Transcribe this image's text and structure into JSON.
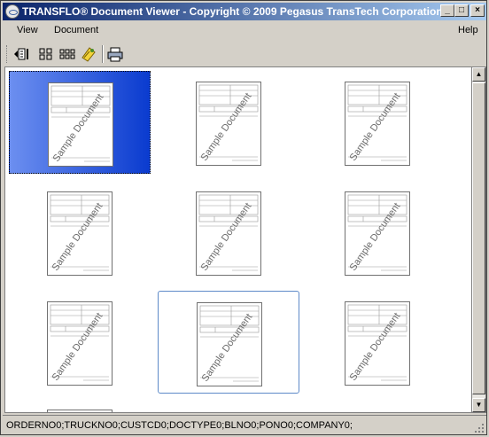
{
  "window": {
    "title": "TRANSFLO® Document Viewer - Copyright © 2009 Pegasus TransTech Corporation...",
    "controls": {
      "minimize": "_",
      "maximize": "□",
      "close": "×"
    }
  },
  "menubar": {
    "items": [
      {
        "label": "View"
      },
      {
        "label": "Document"
      },
      {
        "label": "Help"
      }
    ]
  },
  "toolbar": {
    "buttons": [
      {
        "icon": "single-page-view-icon"
      },
      {
        "icon": "grid-2x2-icon"
      },
      {
        "icon": "grid-3x3-icon"
      },
      {
        "icon": "annotate-icon"
      },
      {
        "icon": "print-icon"
      }
    ]
  },
  "thumbnails": {
    "watermark": "Sample Document",
    "items": [
      {
        "state": "selected"
      },
      {
        "state": "normal"
      },
      {
        "state": "normal"
      },
      {
        "state": "normal"
      },
      {
        "state": "normal"
      },
      {
        "state": "normal"
      },
      {
        "state": "normal"
      },
      {
        "state": "hover"
      },
      {
        "state": "normal"
      }
    ]
  },
  "statusbar": {
    "text": "ORDERNO0;TRUCKNO0;CUSTCD0;DOCTYPE0;BLNO0;PONO0;COMPANY0;"
  },
  "colors": {
    "titlebar_start": "#0a246a",
    "titlebar_end": "#a6caf0",
    "selection_start": "#6c8ff0",
    "selection_end": "#0a3bcf",
    "hover_border": "#5e8ac8"
  }
}
